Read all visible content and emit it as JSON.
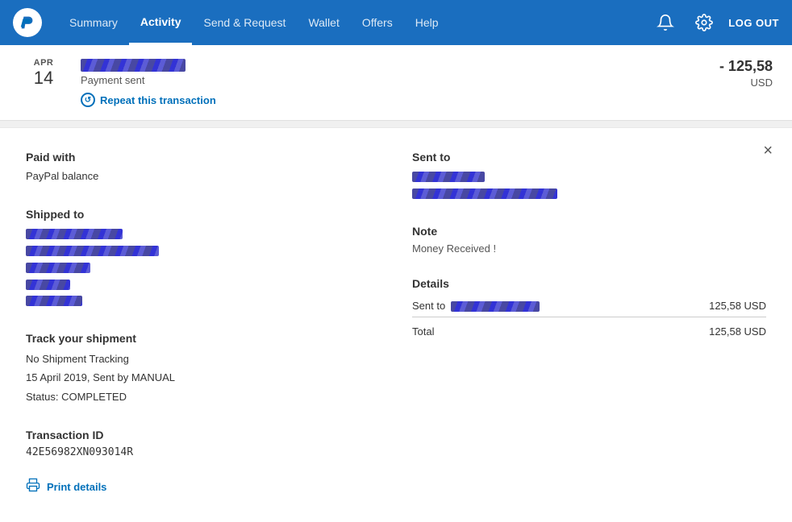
{
  "navbar": {
    "logo_alt": "PayPal",
    "links": [
      {
        "id": "summary",
        "label": "Summary",
        "active": false
      },
      {
        "id": "activity",
        "label": "Activity",
        "active": true
      },
      {
        "id": "send-request",
        "label": "Send & Request",
        "active": false
      },
      {
        "id": "wallet",
        "label": "Wallet",
        "active": false
      },
      {
        "id": "offers",
        "label": "Offers",
        "active": false
      },
      {
        "id": "help",
        "label": "Help",
        "active": false
      }
    ],
    "logout_label": "LOG OUT"
  },
  "transaction": {
    "date_month": "APR",
    "date_day": "14",
    "status": "Payment sent",
    "repeat_label": "Repeat this transaction",
    "amount": "- 125,58",
    "currency": "USD"
  },
  "detail": {
    "close_label": "×",
    "paid_with_label": "Paid with",
    "paid_with_value": "PayPal balance",
    "shipped_to_label": "Shipped to",
    "track_label": "Track your shipment",
    "track_no_tracking": "No Shipment Tracking",
    "track_date": "15 April 2019, Sent by MANUAL",
    "track_status": "Status: COMPLETED",
    "txn_id_label": "Transaction ID",
    "txn_id_value": "42E56982XN093014R",
    "sent_to_label": "Sent to",
    "note_label": "Note",
    "note_value": "Money Received !",
    "details_label": "Details",
    "details_sent_to_label": "Sent to",
    "details_amount": "125,58 USD",
    "total_label": "Total",
    "total_amount": "125,58 USD",
    "print_label": "Print details"
  }
}
